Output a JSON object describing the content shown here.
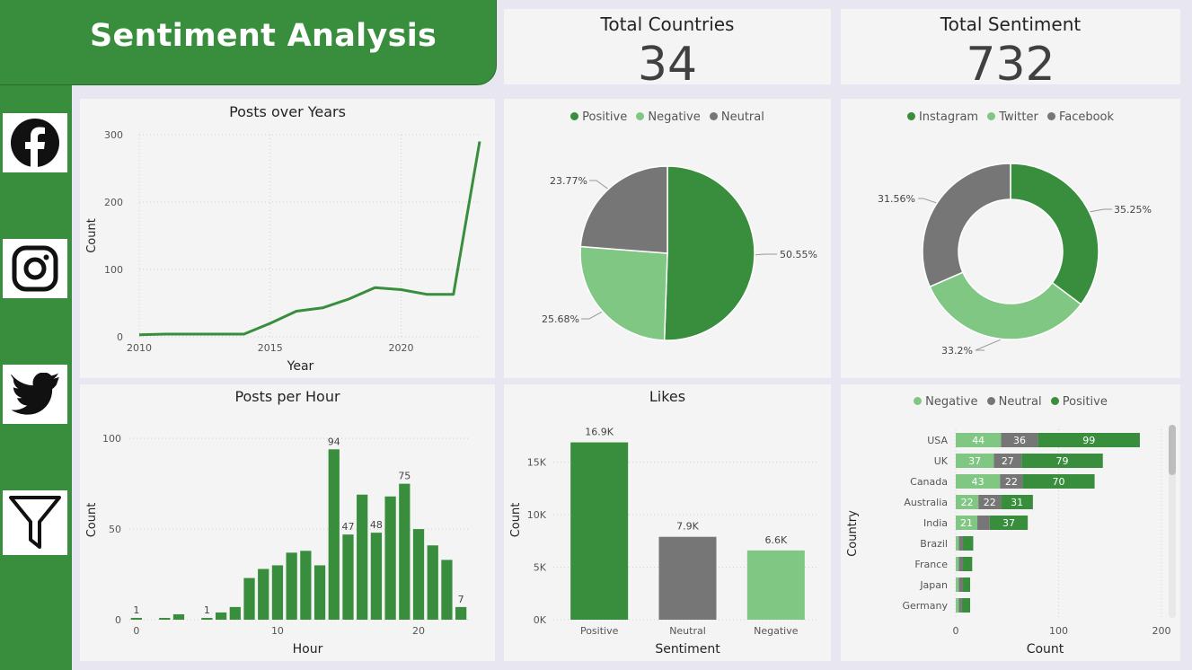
{
  "title": "Sentiment Analysis",
  "colors": {
    "green": "#388e3c",
    "light_green": "#81c784",
    "gray": "#767676"
  },
  "nav": [
    {
      "icon": "facebook-icon"
    },
    {
      "icon": "instagram-icon"
    },
    {
      "icon": "twitter-icon"
    },
    {
      "icon": "filter-icon"
    }
  ],
  "cards": {
    "countries": {
      "label": "Total Countries",
      "value": "34"
    },
    "sentiment": {
      "label": "Total Sentiment",
      "value": "732"
    }
  },
  "chart_data": [
    {
      "id": "posts_over_years",
      "type": "line",
      "title": "Posts over Years",
      "xlabel": "Year",
      "ylabel": "Count",
      "x": [
        2010,
        2011,
        2012,
        2013,
        2014,
        2015,
        2016,
        2017,
        2018,
        2019,
        2020,
        2021,
        2022,
        2023
      ],
      "y": [
        3,
        4,
        4,
        4,
        4,
        20,
        38,
        43,
        56,
        73,
        70,
        63,
        63,
        290
      ],
      "xticks": [
        2010,
        2015,
        2020
      ],
      "yticks": [
        0,
        100,
        200,
        300
      ],
      "xlim": [
        2010,
        2023
      ],
      "ylim": [
        0,
        300
      ],
      "grid": true
    },
    {
      "id": "sentiment_pie",
      "type": "pie",
      "legend": [
        "Positive",
        "Negative",
        "Neutral"
      ],
      "values": [
        50.55,
        25.68,
        23.77
      ],
      "labels": [
        "50.55%",
        "25.68%",
        "23.77%"
      ],
      "colors": [
        "#388e3c",
        "#81c784",
        "#767676"
      ]
    },
    {
      "id": "platform_donut",
      "type": "pie",
      "legend": [
        "Instagram",
        "Twitter",
        "Facebook"
      ],
      "values": [
        35.25,
        33.2,
        31.56
      ],
      "labels": [
        "35.25%",
        "33.2%",
        "31.56%"
      ],
      "colors": [
        "#388e3c",
        "#81c784",
        "#767676"
      ]
    },
    {
      "id": "posts_per_hour",
      "type": "bar",
      "title": "Posts per Hour",
      "xlabel": "Hour",
      "ylabel": "Count",
      "x": [
        0,
        1,
        2,
        3,
        4,
        5,
        6,
        7,
        8,
        9,
        10,
        11,
        12,
        13,
        14,
        15,
        16,
        17,
        18,
        19,
        20,
        21,
        22,
        23
      ],
      "values": [
        1,
        0,
        1,
        3,
        0,
        1,
        4,
        7,
        23,
        28,
        30,
        37,
        38,
        30,
        94,
        47,
        69,
        48,
        68,
        75,
        50,
        41,
        33,
        7
      ],
      "data_labels": {
        "0": "1",
        "5": "1",
        "14": "94",
        "15": "47",
        "17": "48",
        "19": "75",
        "23": "7"
      },
      "xticks": [
        0,
        10,
        20
      ],
      "yticks": [
        0,
        50,
        100
      ],
      "ylim": [
        0,
        110
      ],
      "grid": true
    },
    {
      "id": "likes",
      "type": "bar",
      "title": "Likes",
      "xlabel": "Sentiment",
      "ylabel": "Count",
      "categories": [
        "Positive",
        "Neutral",
        "Negative"
      ],
      "values": [
        16900,
        7900,
        6600
      ],
      "labels": [
        "16.9K",
        "7.9K",
        "6.6K"
      ],
      "colors": [
        "#388e3c",
        "#767676",
        "#81c784"
      ],
      "yticks": [
        "0K",
        "5K",
        "10K",
        "15K"
      ],
      "ylim": [
        0,
        19000
      ],
      "grid": true
    },
    {
      "id": "country_sentiment",
      "type": "bar",
      "orientation": "horizontal",
      "stacked": true,
      "xlabel": "Count",
      "ylabel": "Country",
      "legend": [
        "Negative",
        "Neutral",
        "Positive"
      ],
      "categories": [
        "USA",
        "UK",
        "Canada",
        "Australia",
        "India",
        "Brazil",
        "France",
        "Japan",
        "Germany"
      ],
      "series": [
        {
          "name": "Negative",
          "values": [
            44,
            37,
            43,
            22,
            21,
            3,
            3,
            3,
            3
          ]
        },
        {
          "name": "Neutral",
          "values": [
            36,
            27,
            22,
            22,
            12,
            4,
            4,
            4,
            3
          ]
        },
        {
          "name": "Positive",
          "values": [
            99,
            79,
            70,
            31,
            37,
            10,
            9,
            7,
            8
          ]
        }
      ],
      "xticks": [
        0,
        100,
        200
      ],
      "xlim": [
        0,
        200
      ],
      "grid": true
    }
  ]
}
